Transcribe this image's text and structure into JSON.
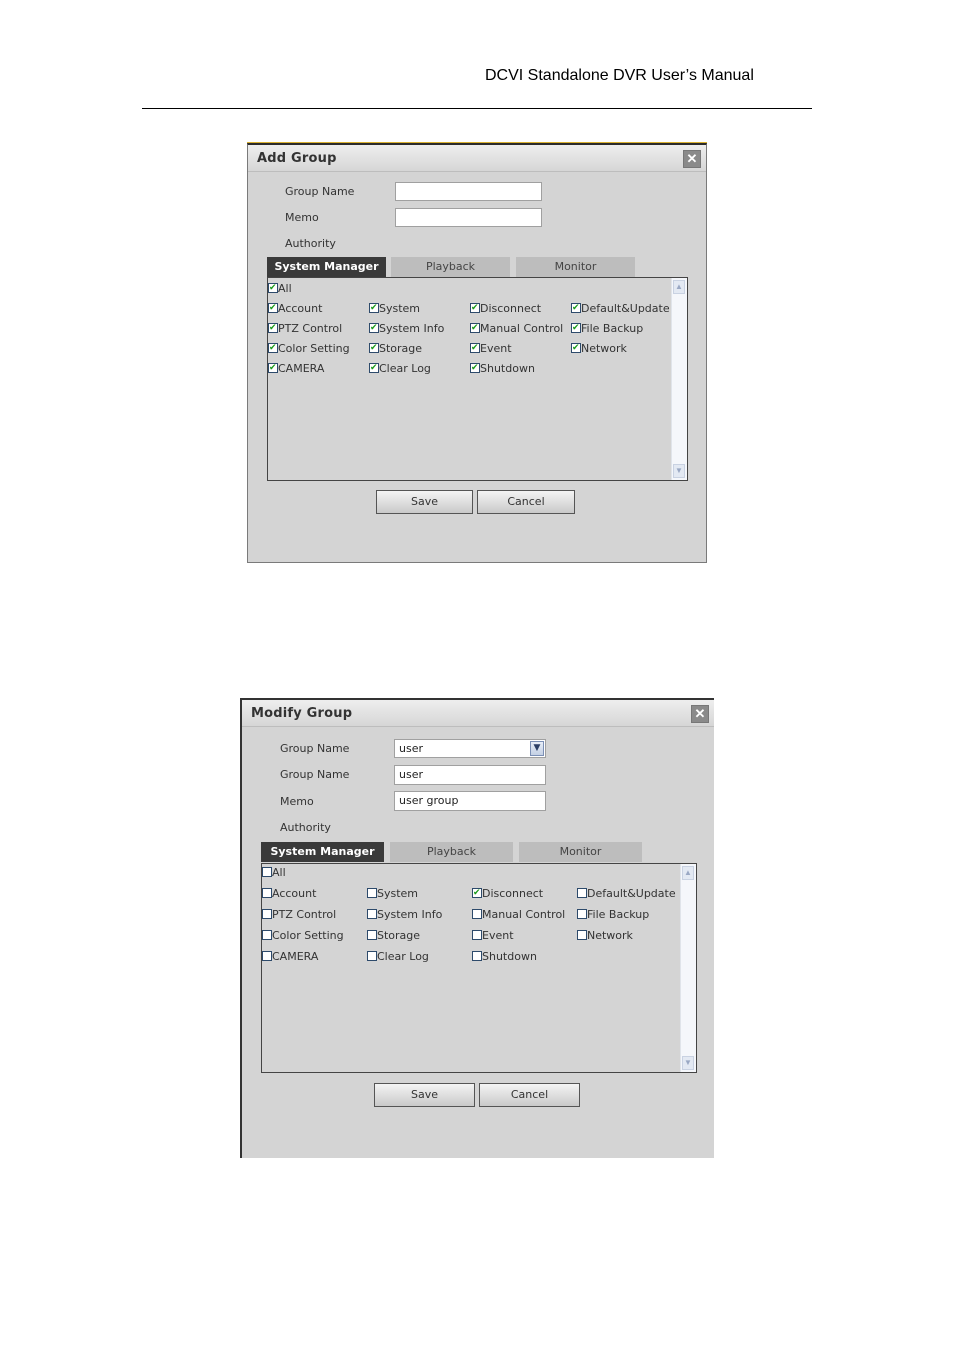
{
  "document": {
    "header": "DCVI Standalone DVR User’s Manual"
  },
  "add_group": {
    "title": "Add Group",
    "fields": {
      "group_name_label": "Group Name",
      "group_name_value": "",
      "memo_label": "Memo",
      "memo_value": "",
      "authority_label": "Authority"
    },
    "tabs": [
      {
        "label": "System Manager",
        "active": true
      },
      {
        "label": "Playback",
        "active": false
      },
      {
        "label": "Monitor",
        "active": false
      }
    ],
    "all": {
      "label": "All",
      "checked": true
    },
    "permissions": [
      {
        "label": "Account",
        "checked": true
      },
      {
        "label": "System",
        "checked": true
      },
      {
        "label": "Disconnect",
        "checked": true
      },
      {
        "label": "Default&Update",
        "checked": true
      },
      {
        "label": "PTZ Control",
        "checked": true
      },
      {
        "label": "System Info",
        "checked": true
      },
      {
        "label": "Manual Control",
        "checked": true
      },
      {
        "label": "File Backup",
        "checked": true
      },
      {
        "label": "Color Setting",
        "checked": true
      },
      {
        "label": "Storage",
        "checked": true
      },
      {
        "label": "Event",
        "checked": true
      },
      {
        "label": "Network",
        "checked": true
      },
      {
        "label": "CAMERA",
        "checked": true
      },
      {
        "label": "Clear Log",
        "checked": true
      },
      {
        "label": "Shutdown",
        "checked": true
      }
    ],
    "buttons": {
      "save": "Save",
      "cancel": "Cancel"
    }
  },
  "modify_group": {
    "title": "Modify Group",
    "fields": {
      "group_select_label": "Group Name",
      "group_select_value": "user",
      "group_name_label": "Group Name",
      "group_name_value": "user",
      "memo_label": "Memo",
      "memo_value": "user group",
      "authority_label": "Authority"
    },
    "tabs": [
      {
        "label": "System Manager",
        "active": true
      },
      {
        "label": "Playback",
        "active": false
      },
      {
        "label": "Monitor",
        "active": false
      }
    ],
    "all": {
      "label": "All",
      "checked": false
    },
    "permissions": [
      {
        "label": "Account",
        "checked": false
      },
      {
        "label": "System",
        "checked": false
      },
      {
        "label": "Disconnect",
        "checked": true
      },
      {
        "label": "Default&Update",
        "checked": false
      },
      {
        "label": "PTZ Control",
        "checked": false
      },
      {
        "label": "System Info",
        "checked": false
      },
      {
        "label": "Manual Control",
        "checked": false
      },
      {
        "label": "File Backup",
        "checked": false
      },
      {
        "label": "Color Setting",
        "checked": false
      },
      {
        "label": "Storage",
        "checked": false
      },
      {
        "label": "Event",
        "checked": false
      },
      {
        "label": "Network",
        "checked": false
      },
      {
        "label": "CAMERA",
        "checked": false
      },
      {
        "label": "Clear Log",
        "checked": false
      },
      {
        "label": "Shutdown",
        "checked": false
      }
    ],
    "buttons": {
      "save": "Save",
      "cancel": "Cancel"
    }
  }
}
